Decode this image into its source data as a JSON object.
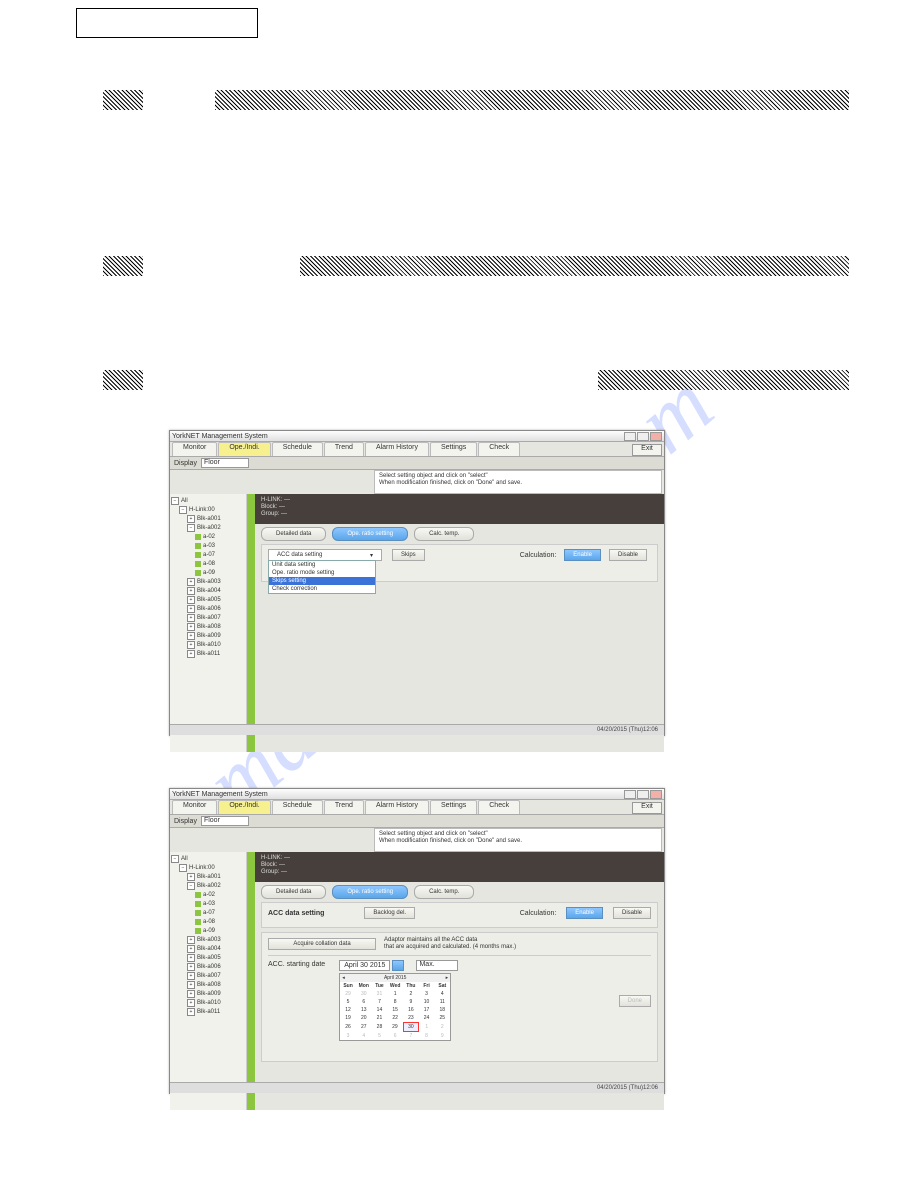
{
  "watermark": "manualshive.com",
  "app": {
    "title": "YorkNET Management System",
    "tabs": [
      "Monitor",
      "Ope./Indi.",
      "Schedule",
      "Trend",
      "Alarm History",
      "Settings",
      "Check"
    ],
    "activeTab": 1,
    "exit": "Exit",
    "display_label": "Display",
    "display_value": "Floor",
    "hint1": "Select setting object and click on \"select\"",
    "hint2": "When modification finished, click on \"Done\" and save.",
    "hdr_labels": [
      "H-LINK:",
      "Block:",
      "Group:"
    ],
    "hdr_vals": [
      "—",
      "—",
      "—"
    ],
    "btn_detail": "Detailed data",
    "btn_ope": "Ope. ratio setting",
    "btn_calc": "Calc. temp.",
    "calc_label": "Calculation:",
    "btn_enable": "Enable",
    "btn_disable": "Disable",
    "statusbar": "04/20/2015 (Thu)12:06",
    "tree_top": "All",
    "tree_hlink": "H-Link:00",
    "tree_blk1": "Blk-a001",
    "tree_blk2": "Blk-a002",
    "tree_u": [
      "a-02",
      "a-03",
      "a-07",
      "a-08",
      "a-09"
    ],
    "tree_coll": [
      "Blk-a003",
      "Blk-a004",
      "Blk-a005",
      "Blk-a006",
      "Blk-a007",
      "Blk-a008",
      "Blk-a009",
      "Blk-a010",
      "Blk-a011"
    ]
  },
  "fig1": {
    "dd_label": "ACC data setting",
    "btn_skips": "Skips",
    "options": [
      "Unit data setting",
      "Ope. ratio mode setting",
      "Skips setting",
      "Check correction"
    ],
    "selected": 2
  },
  "fig2": {
    "panel_title": "ACC data setting",
    "btn_backlog": "Backlog del.",
    "btn_acquire": "Acquire collation data",
    "acq_note1": "Adaptor maintains all the ACC data",
    "acq_note2": "that are acquired and calculated. (4 months max.)",
    "starting_label": "ACC. starting date",
    "date_value": "April   30  2015",
    "max_label": "Max.",
    "btn_done": "Done",
    "cal": {
      "month": "April 2015",
      "dow": [
        "Sun",
        "Mon",
        "Tue",
        "Wed",
        "Thu",
        "Fri",
        "Sat"
      ],
      "rows": [
        [
          {
            "d": "29",
            "o": 1
          },
          {
            "d": "30",
            "o": 1
          },
          {
            "d": "31",
            "o": 1
          },
          {
            "d": "1"
          },
          {
            "d": "2"
          },
          {
            "d": "3"
          },
          {
            "d": "4"
          }
        ],
        [
          {
            "d": "5"
          },
          {
            "d": "6"
          },
          {
            "d": "7"
          },
          {
            "d": "8"
          },
          {
            "d": "9"
          },
          {
            "d": "10"
          },
          {
            "d": "11"
          }
        ],
        [
          {
            "d": "12"
          },
          {
            "d": "13"
          },
          {
            "d": "14"
          },
          {
            "d": "15"
          },
          {
            "d": "16"
          },
          {
            "d": "17"
          },
          {
            "d": "18"
          }
        ],
        [
          {
            "d": "19"
          },
          {
            "d": "20"
          },
          {
            "d": "21"
          },
          {
            "d": "22"
          },
          {
            "d": "23"
          },
          {
            "d": "24"
          },
          {
            "d": "25"
          }
        ],
        [
          {
            "d": "26"
          },
          {
            "d": "27"
          },
          {
            "d": "28"
          },
          {
            "d": "29"
          },
          {
            "d": "30",
            "t": 1
          },
          {
            "d": "1",
            "o": 1
          },
          {
            "d": "2",
            "o": 1
          }
        ],
        [
          {
            "d": "3",
            "o": 1
          },
          {
            "d": "4",
            "o": 1
          },
          {
            "d": "5",
            "o": 1
          },
          {
            "d": "6",
            "o": 1
          },
          {
            "d": "7",
            "o": 1
          },
          {
            "d": "8",
            "o": 1
          },
          {
            "d": "9",
            "o": 1
          }
        ]
      ]
    }
  }
}
